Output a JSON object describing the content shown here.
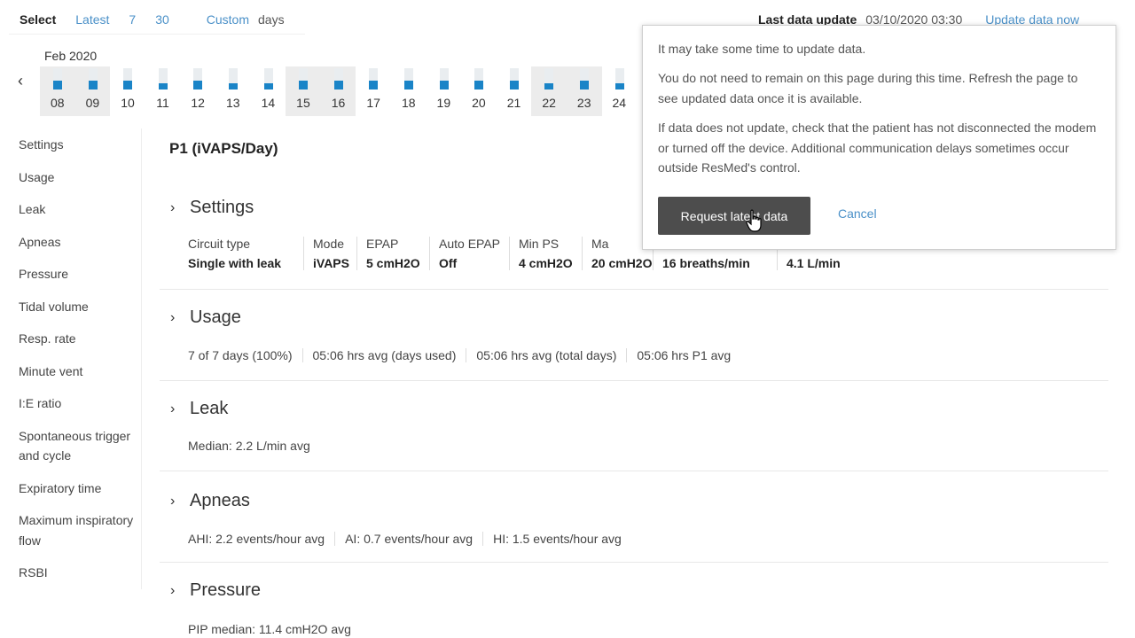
{
  "select": {
    "label": "Select",
    "latest": "Latest",
    "seven": "7",
    "thirty": "30",
    "custom": "Custom",
    "days": "days"
  },
  "last_update": {
    "title": "Last data update",
    "value": "03/10/2020 03:30",
    "link": "Update data now"
  },
  "calendar": {
    "month": "Feb 2020",
    "prev_icon": "chevron-left-icon",
    "days": [
      {
        "num": "08",
        "usage": 0.4,
        "highlighted": true
      },
      {
        "num": "09",
        "usage": 0.4,
        "highlighted": true
      },
      {
        "num": "10",
        "usage": 0.4,
        "highlighted": false
      },
      {
        "num": "11",
        "usage": 0.3,
        "highlighted": false
      },
      {
        "num": "12",
        "usage": 0.4,
        "highlighted": false
      },
      {
        "num": "13",
        "usage": 0.3,
        "highlighted": false
      },
      {
        "num": "14",
        "usage": 0.3,
        "highlighted": false
      },
      {
        "num": "15",
        "usage": 0.4,
        "highlighted": true
      },
      {
        "num": "16",
        "usage": 0.4,
        "highlighted": true
      },
      {
        "num": "17",
        "usage": 0.4,
        "highlighted": false
      },
      {
        "num": "18",
        "usage": 0.4,
        "highlighted": false
      },
      {
        "num": "19",
        "usage": 0.4,
        "highlighted": false
      },
      {
        "num": "20",
        "usage": 0.4,
        "highlighted": false
      },
      {
        "num": "21",
        "usage": 0.4,
        "highlighted": false
      },
      {
        "num": "22",
        "usage": 0.3,
        "highlighted": true
      },
      {
        "num": "23",
        "usage": 0.4,
        "highlighted": true
      },
      {
        "num": "24",
        "usage": 0.3,
        "highlighted": false
      }
    ]
  },
  "sidebar": {
    "items": [
      {
        "label": "Settings"
      },
      {
        "label": "Usage"
      },
      {
        "label": "Leak"
      },
      {
        "label": "Apneas"
      },
      {
        "label": "Pressure"
      },
      {
        "label": "Tidal volume"
      },
      {
        "label": "Resp. rate"
      },
      {
        "label": "Minute vent"
      },
      {
        "label": "I:E ratio"
      },
      {
        "label": "Spontaneous trigger and cycle"
      },
      {
        "label": "Expiratory time"
      },
      {
        "label": "Maximum inspiratory flow"
      },
      {
        "label": "RSBI"
      }
    ]
  },
  "main": {
    "title": "P1 (iVAPS/Day)",
    "settings": {
      "title": "Settings",
      "fields": [
        {
          "key": "Circuit type",
          "value": "Single with leak"
        },
        {
          "key": "Mode",
          "value": "iVAPS"
        },
        {
          "key": "EPAP",
          "value": "5 cmH2O"
        },
        {
          "key": "Auto EPAP",
          "value": "Off"
        },
        {
          "key": "Min PS",
          "value": "4 cmH2O"
        },
        {
          "key": "Ma",
          "value": "20 cmH2O"
        },
        {
          "key": "",
          "value": "16 breaths/min"
        },
        {
          "key": "",
          "value": "4.1 L/min"
        }
      ]
    },
    "usage": {
      "title": "Usage",
      "items": [
        "7 of 7 days (100%)",
        "05:06 hrs avg (days used)",
        "05:06 hrs avg (total days)",
        "05:06 hrs P1 avg"
      ]
    },
    "leak": {
      "title": "Leak",
      "items": [
        "Median: 2.2 L/min avg"
      ]
    },
    "apneas": {
      "title": "Apneas",
      "items": [
        "AHI: 2.2 events/hour avg",
        "AI: 0.7 events/hour avg",
        "HI: 1.5 events/hour avg"
      ]
    },
    "pressure": {
      "title": "Pressure",
      "items": [
        "PIP median: 11.4 cmH2O avg"
      ]
    }
  },
  "popup": {
    "p1": "It may take some time to update data.",
    "p2": "You do not need to remain on this page during this time. Refresh the page to see updated data once it is available.",
    "p3": "If data does not update, check that the patient has not disconnected the modem or turned off the device. Additional communication delays sometimes occur outside ResMed's control.",
    "request_label": "Request latest data",
    "cancel_label": "Cancel"
  },
  "colors": {
    "accent": "#1a84c7",
    "link": "#4a90c8",
    "button": "#4d4d4d"
  }
}
